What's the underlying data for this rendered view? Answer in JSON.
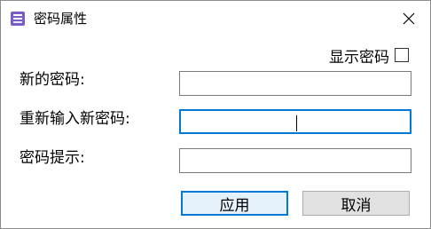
{
  "window": {
    "title": "密码属性",
    "close_glyph": "✕"
  },
  "form": {
    "show_password_label": "显示密码",
    "new_password_label": "新的密码:",
    "reenter_password_label": "重新输入新密码:",
    "hint_label": "密码提示:",
    "new_password_value": "",
    "reenter_password_value": "",
    "hint_value": ""
  },
  "buttons": {
    "apply": "应用",
    "cancel": "取消"
  }
}
